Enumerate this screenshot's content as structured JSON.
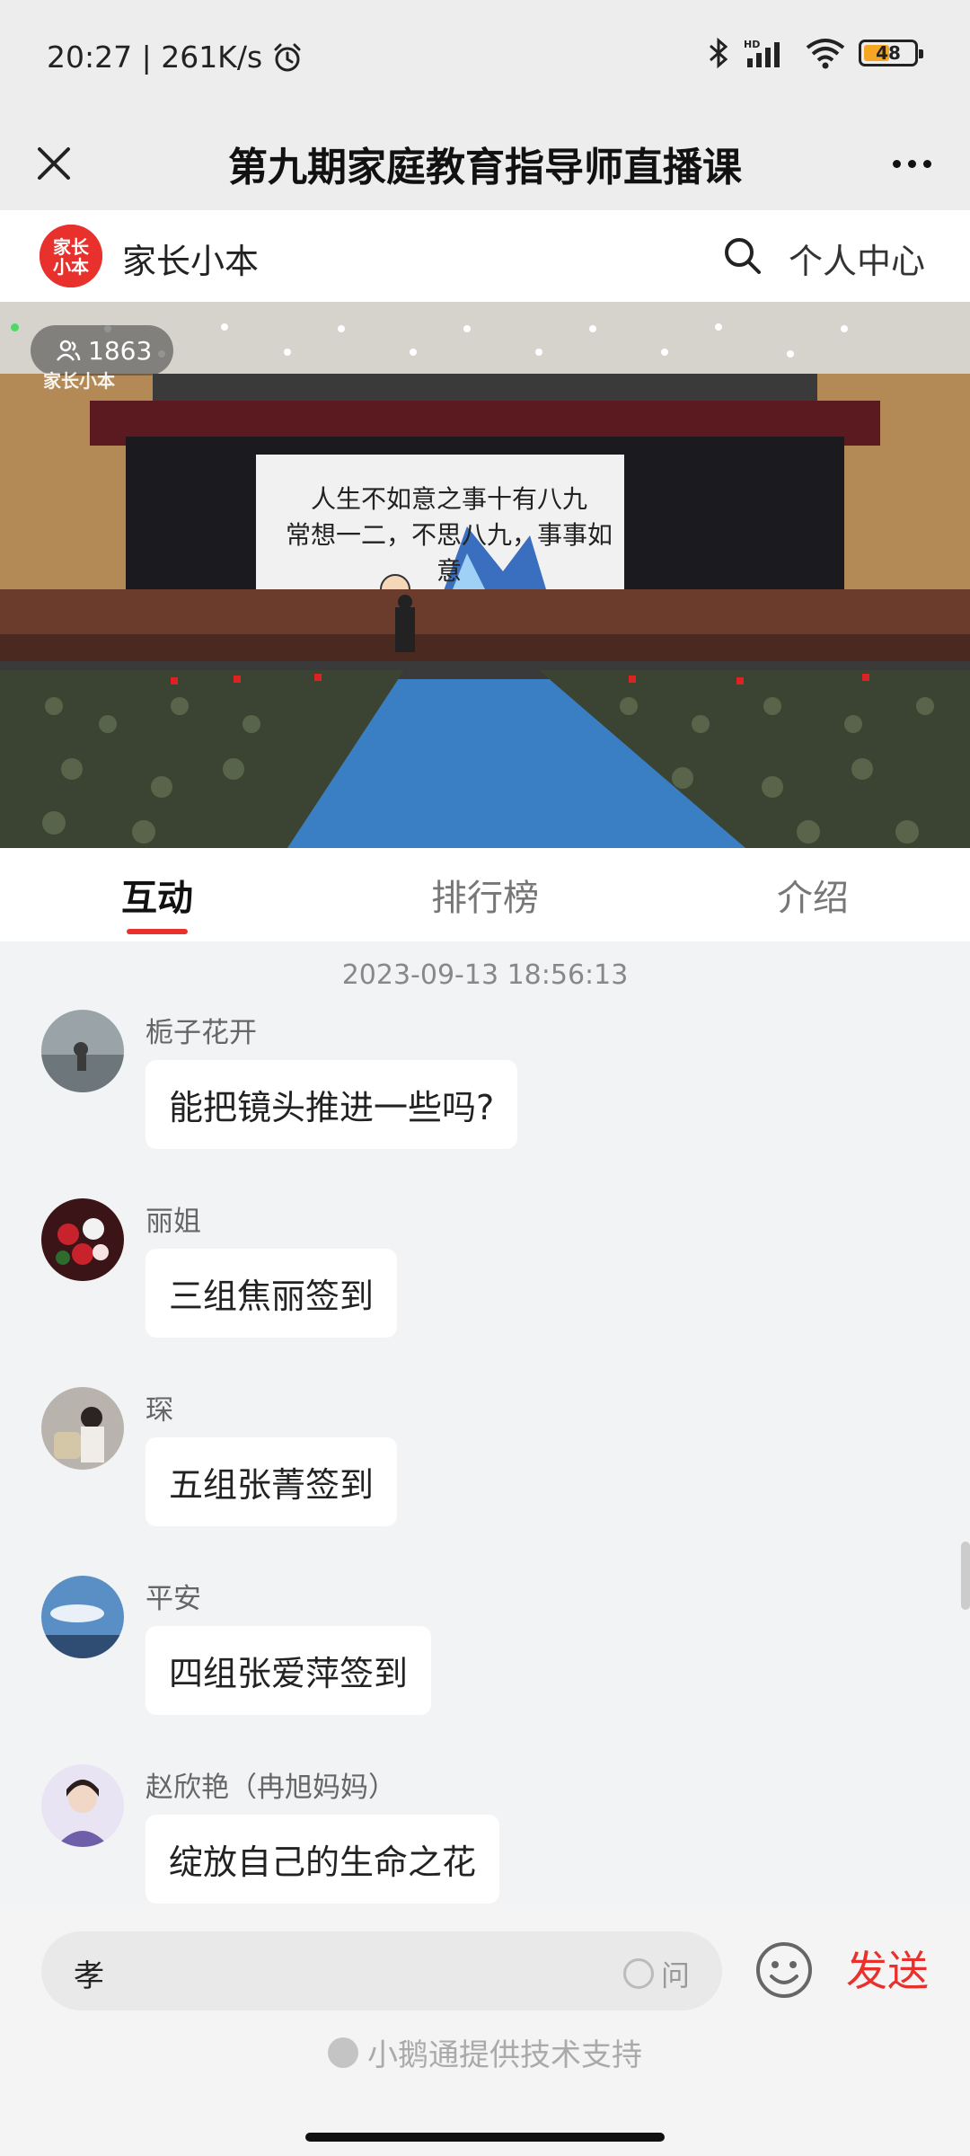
{
  "status_bar": {
    "time_speed": "20:27 | 261K/s",
    "battery": "48",
    "icons": [
      "alarm-icon",
      "bluetooth-icon",
      "signal-icon",
      "wifi-icon",
      "battery-icon"
    ]
  },
  "header": {
    "title": "第九期家庭教育指导师直播课",
    "close_icon": "close-icon",
    "more_icon": "more-icon"
  },
  "brand": {
    "logo_text": "家长\n小本",
    "name": "家长小本",
    "profile_label": "个人中心"
  },
  "video": {
    "viewer_count": "1863",
    "watermark": "家长小本",
    "screen_line1": "人生不如意之事十有八九",
    "screen_line2": "常想一二，不思八九，事事如意"
  },
  "tabs": [
    {
      "label": "互动",
      "active": true
    },
    {
      "label": "排行榜",
      "active": false
    },
    {
      "label": "介绍",
      "active": false
    }
  ],
  "chat": {
    "timestamp": "2023-09-13 18:56:13",
    "messages": [
      {
        "name": "栀子花开",
        "text": "能把镜头推进一些吗?"
      },
      {
        "name": "丽姐",
        "text": "三组焦丽签到"
      },
      {
        "name": "琛",
        "text": "五组张菁签到"
      },
      {
        "name": "平安",
        "text": "四组张爱萍签到"
      },
      {
        "name": "赵欣艳（冉旭妈妈）",
        "text": "绽放自己的生命之花"
      }
    ]
  },
  "input": {
    "value": "孝",
    "ask_label": "问",
    "send_label": "发送",
    "powered_by": "小鹅通提供技术支持"
  },
  "colors": {
    "accent": "#e8302c",
    "chat_bg": "#f2f3f5"
  }
}
